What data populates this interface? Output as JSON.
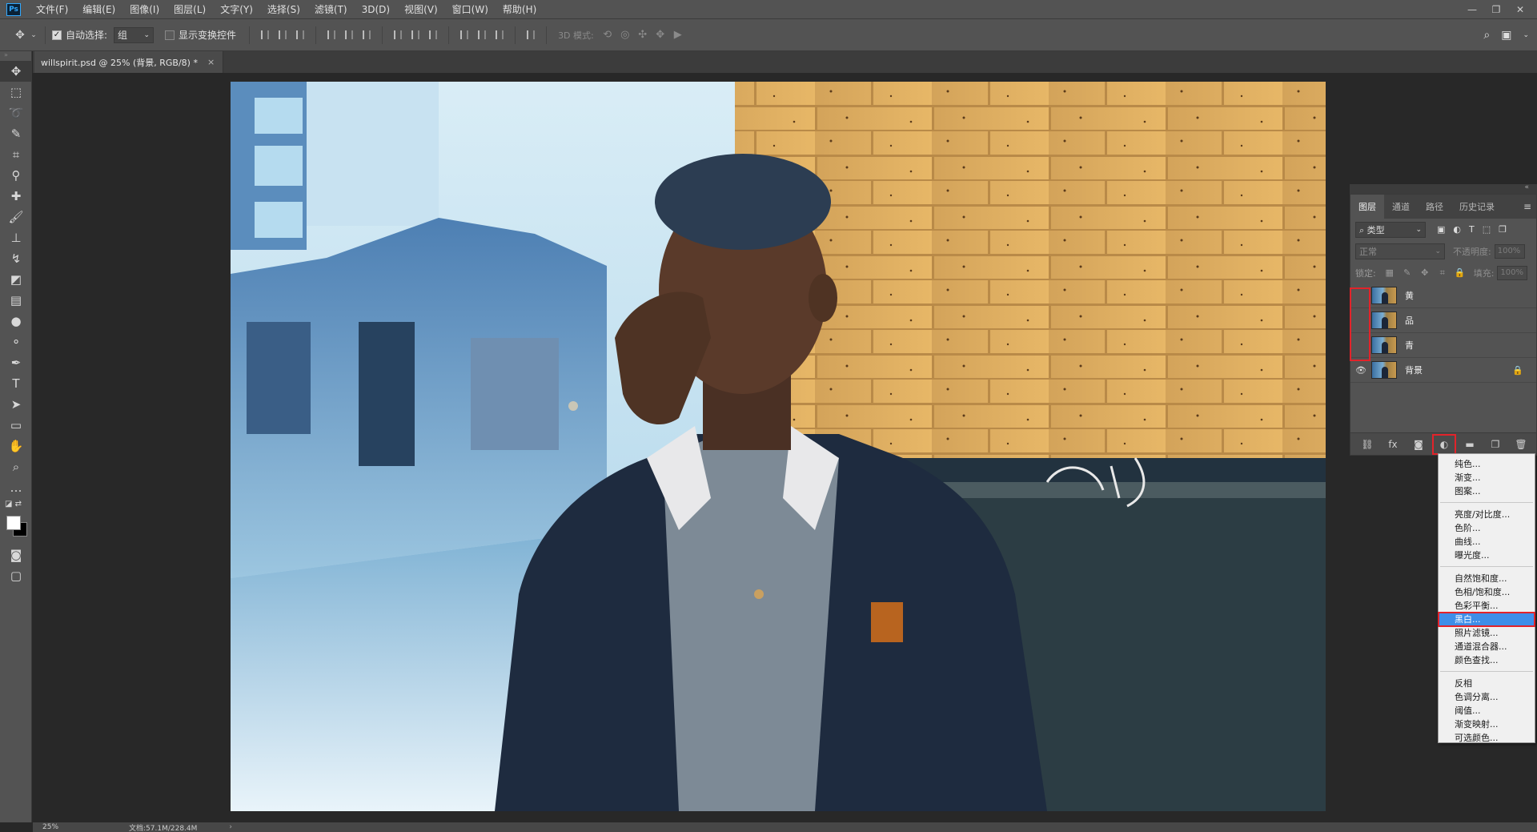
{
  "app": {
    "logo": "Ps"
  },
  "menubar": {
    "items": [
      "文件(F)",
      "编辑(E)",
      "图像(I)",
      "图层(L)",
      "文字(Y)",
      "选择(S)",
      "滤镜(T)",
      "3D(D)",
      "视图(V)",
      "窗口(W)",
      "帮助(H)"
    ]
  },
  "options": {
    "auto_select_label": "自动选择:",
    "auto_select_checked": true,
    "auto_select_value": "组",
    "show_transform_label": "显示变换控件",
    "show_transform_checked": false,
    "mode_3d_label": "3D 模式:"
  },
  "document": {
    "tab_title": "willspirit.psd @ 25% (背景, RGB/8) *",
    "close": "×"
  },
  "status": {
    "zoom": "25%",
    "doc_size": "文档:57.1M/228.4M",
    "arrow": "›"
  },
  "layers_panel": {
    "tabs": [
      "图层",
      "通道",
      "路径",
      "历史记录"
    ],
    "active_tab": "图层",
    "kind_filter": "类型",
    "blend_mode": "正常",
    "opacity_label": "不透明度:",
    "opacity_value": "100%",
    "lock_label": "锁定:",
    "fill_label": "填充:",
    "fill_value": "100%",
    "layers": [
      {
        "name": "黄",
        "visible": false
      },
      {
        "name": "品",
        "visible": false
      },
      {
        "name": "青",
        "visible": false
      },
      {
        "name": "背景",
        "visible": true,
        "locked": true
      }
    ]
  },
  "adjustment_menu": {
    "group1": [
      "纯色...",
      "渐变...",
      "图案..."
    ],
    "group2": [
      "亮度/对比度...",
      "色阶...",
      "曲线...",
      "曝光度..."
    ],
    "group3": [
      "自然饱和度...",
      "色相/饱和度...",
      "色彩平衡...",
      "黑白...",
      "照片滤镜...",
      "通道混合器...",
      "颜色查找..."
    ],
    "group4": [
      "反相",
      "色调分离...",
      "阈值...",
      "渐变映射...",
      "可选颜色..."
    ],
    "highlighted": "黑白..."
  },
  "colors": {
    "highlight_red": "#e2232a",
    "menu_selection": "#3e8ee8",
    "panel_bg": "#535353"
  }
}
